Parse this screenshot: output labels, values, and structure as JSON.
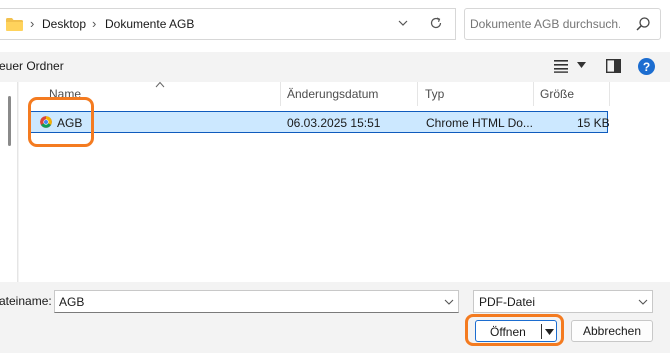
{
  "address_bar": {
    "breadcrumbs": [
      "Desktop",
      "Dokumente AGB"
    ],
    "search_placeholder": "Dokumente AGB durchsuch..."
  },
  "command_bar": {
    "new_folder_label": "euer Ordner",
    "help_label": "?"
  },
  "file_list": {
    "columns": [
      "Name",
      "Änderungsdatum",
      "Typ",
      "Größe"
    ],
    "rows": [
      {
        "name": "AGB",
        "modified": "06.03.2025 15:51",
        "type": "Chrome HTML Do...",
        "size": "15 KB",
        "icon": "chrome-icon",
        "selected": true
      }
    ]
  },
  "bottom": {
    "filename_label": "ateiname:",
    "filename_value": "AGB",
    "filetype_value": "PDF-Datei",
    "open_label": "Öffnen",
    "cancel_label": "Abbrechen"
  },
  "colors": {
    "highlight": "#f47b20",
    "selection": "#cce8ff",
    "accent": "#1c6dd0"
  }
}
